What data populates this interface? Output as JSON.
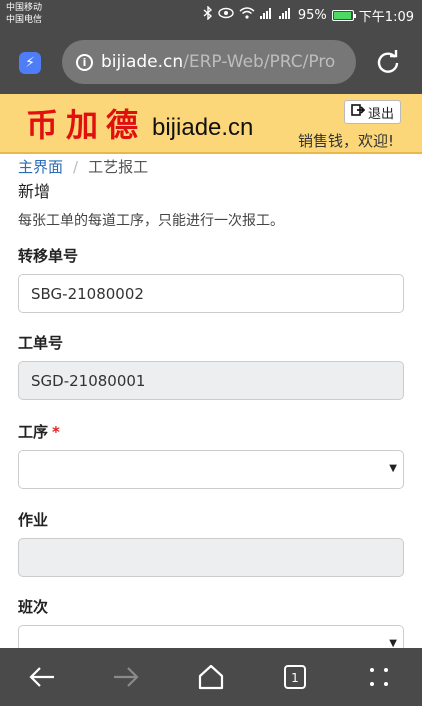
{
  "status": {
    "carrier1": "中国移动",
    "carrier2": "中国电信",
    "battery": "95%",
    "battery_level": 0.95,
    "time": "下午1:09"
  },
  "browser": {
    "url_host": "bijiade.cn",
    "url_path": "/ERP-Web/PRC/Pro"
  },
  "header": {
    "logo_cn": "币加德",
    "logo_en": "bijiade.cn",
    "logout": "退出",
    "welcome": "销售钱，欢迎!"
  },
  "breadcrumb": {
    "home": "主界面",
    "separator": "/",
    "current": "工艺报工"
  },
  "page": {
    "title": "新增",
    "note": "每张工单的每道工序，只能进行一次报工。"
  },
  "form": {
    "transfer_no_label": "转移单号",
    "transfer_no_value": "SBG-21080002",
    "work_order_label": "工单号",
    "work_order_value": "SGD-21080001",
    "process_label": "工序",
    "process_required": "*",
    "process_value": "",
    "operation_label": "作业",
    "operation_value": "",
    "shift_label": "班次",
    "shift_value": ""
  },
  "colors": {
    "accent_link": "#2a6db5",
    "banner_bg": "#fcd77a",
    "logo_red": "#e01010",
    "required": "#dd2222"
  }
}
